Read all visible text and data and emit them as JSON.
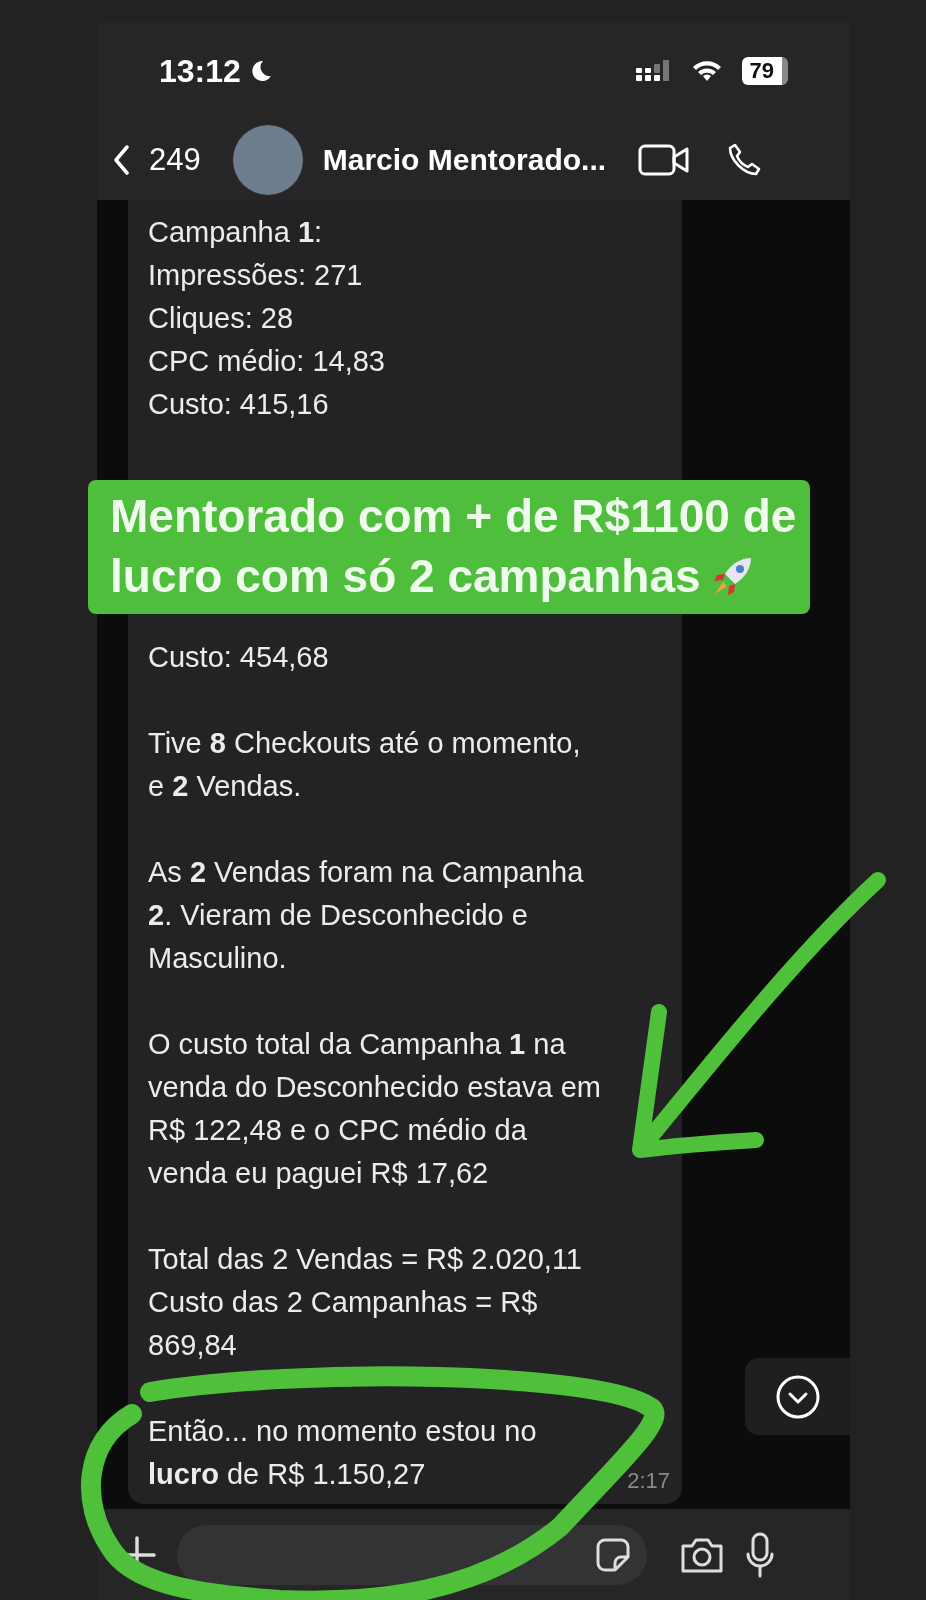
{
  "status_bar": {
    "time": "13:12",
    "battery": "79"
  },
  "header": {
    "back_count": "249",
    "contact_name": "Marcio Mentorado..."
  },
  "message": {
    "blocks": [
      {
        "text": "Campanha **1**:\nImpressões: 271\nCliques: 28\nCPC médio: 14,83\nCusto: 415,16"
      },
      {
        "text": "Custo: 454,68"
      },
      {
        "text": "Tive **8** Checkouts até o momento,\ne **2** Vendas."
      },
      {
        "text": "As **2** Vendas foram na Campanha\n**2**. Vieram de Desconhecido e\nMasculino."
      },
      {
        "text": "O custo total da Campanha **1** na\nvenda do Desconhecido estava em\nR$ 122,48 e o CPC médio da\nvenda eu paguei R$ 17,62"
      },
      {
        "text": "Total das 2 Vendas = R$ 2.020,11\nCusto das 2 Campanhas = R$\n869,84"
      },
      {
        "text": "Então... no momento estou no\n**lucro** de R$ 1.150,27"
      }
    ],
    "time": "2:17"
  },
  "caption": {
    "lines": [
      "Mentorado com + de R$1100 de",
      "lucro com só 2 campanhas"
    ]
  }
}
